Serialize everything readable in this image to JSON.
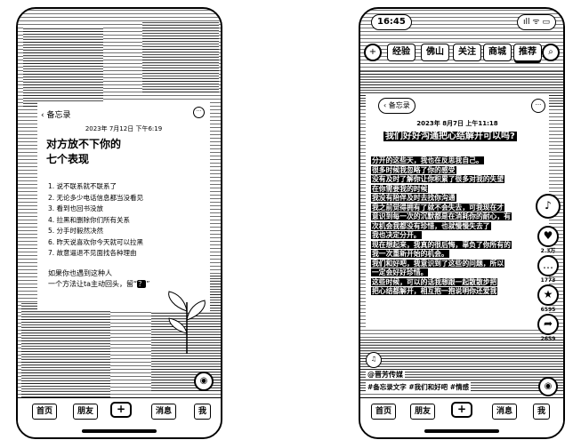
{
  "left_phone": {
    "memo": {
      "back_label": "备忘录",
      "more_icon": "ellipsis-circle-icon",
      "date": "2023年 7月12日 下午6:19",
      "title_line1": "对方放不下你的",
      "title_line2": "七个表现",
      "items": [
        "1. 说不联系就不联系了",
        "2. 无论多少电话信息都当没看见",
        "3. 看到也回书没放",
        "4. 拉黑和删除你们所有关系",
        "5. 分手时毅然决然",
        "6. 昨天说喜欢你今天就可以拉黑",
        "7. 故意逼退不见面找各种理由"
      ],
      "foot_line1": "如果你也遇到这种人",
      "foot_line2": "一个方法让ta主动回头，留“",
      "foot_emoji": "？",
      "foot_tail": "”"
    },
    "bottom_nav": [
      "首页",
      "朋友",
      "+",
      "消息",
      "我"
    ]
  },
  "right_phone": {
    "status": {
      "time": "16:45",
      "icons": "ıll ᯤ ▭"
    },
    "top_tabs": [
      "经验",
      "佛山",
      "关注",
      "商城",
      "推荐"
    ],
    "memo": {
      "back_label": "备忘录",
      "date": "2023年 8月7日 上午11:18",
      "title": "我们好好沟通把心结解开可以吗?",
      "body_lines": [
        "分开的这些天，我也在反思我自己。",
        "很多时候我忽略了你的感受",
        "没有及时了解你让你积累了很多对我的失望",
        "在你需要我的时候",
        "我没有陪伴及时去找你沟通",
        "我之前觉得拥有了就不会失去，可我现在才",
        "意识到每一次的沉默都是在消耗你的耐心，有",
        "次机会我都没有珍惜，也就慢慢失去了",
        "我也决定分开。",
        "现在想起来，我真的很后悔，辜负了你所有的",
        "我一次重新开始的机会。",
        "我们和好吧，我意识到了这些的问题，所以",
        "一定会好好珍惜。",
        "这些时候，可以的话我想跟一起散散步把",
        "把心结都解开，相互抱一抱说明你还爱我",
        ""
      ]
    },
    "side": {
      "likes": "2.3万",
      "comments": "1773",
      "stars": "6595",
      "shares": "2659"
    },
    "author": "@晋芳传媒",
    "hashtags": "#备忘录文字 #我们和好吧 #情感",
    "bottom_nav": [
      "首页",
      "朋友",
      "+",
      "消息",
      "我"
    ]
  }
}
